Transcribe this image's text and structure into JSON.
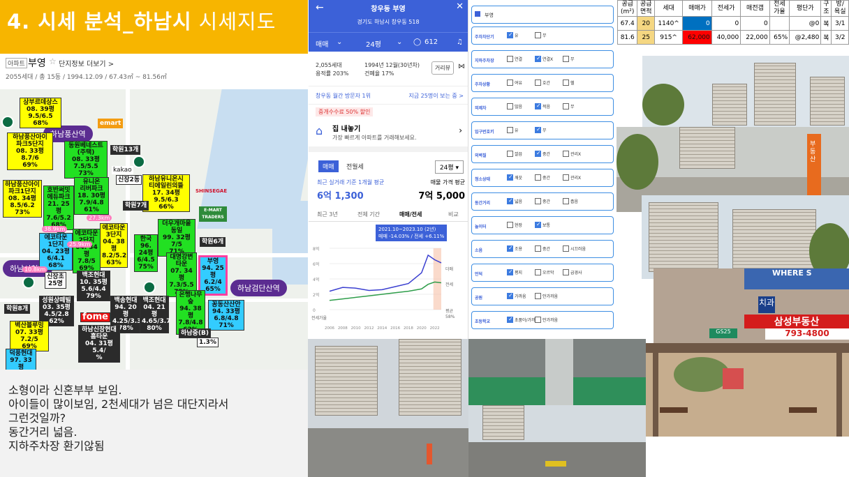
{
  "title": {
    "main": "4. 시세 분석_하남시",
    "sub": "시세지도"
  },
  "apartment": {
    "tag": "아파트",
    "name": "부영",
    "more": "단지정보 더보기 >",
    "summary": "2055세대 / 총 15동 / 1994.12.09 / 67.43㎡ ~ 81.56㎡"
  },
  "map": {
    "stations": [
      "하남풍산역",
      "하남시청역",
      "하남검단산역"
    ],
    "brands": [
      "emart",
      "kakao",
      "신장2동",
      "SHINSEGAE",
      "E-MART TRADERS",
      "fome"
    ],
    "labels": [
      {
        "text": "상부르데상스\n08. 39평\n9.5/6.5\n68%",
        "color": "y"
      },
      {
        "text": "하남풍산아이\n파크5단지\n08. 33평\n8.7/6\n69%",
        "color": "y"
      },
      {
        "text": "동원베네스트\n(주택)\n08. 33평\n7.5/5.5\n73%",
        "color": "g"
      },
      {
        "text": "학원13개",
        "color": "dk"
      },
      {
        "text": "하남풍산아이\n파크1단지\n08. 34평\n8.5/6.2\n73%",
        "color": "y"
      },
      {
        "text": "호반써밋\n에듀파크\n21. 25평\n7.6/5.2\n68%",
        "color": "g"
      },
      {
        "text": "유니온\n리버파크\n18. 30평\n7.9/4.8\n61%",
        "color": "g"
      },
      {
        "text": "하남유니온시\n티에일린의뜰\n17. 34평\n9.5/6.3\n66%",
        "color": "y"
      },
      {
        "text": "에코타운\n1단지\n04. 23평\n6/4.1\n68%",
        "color": "c"
      },
      {
        "text": "에코타운\n2단지\n04. 34평\n7.8/5\n69%",
        "color": "g"
      },
      {
        "text": "에코타운\n3단지\n04. 38평\n8.2/5.2\n63%",
        "color": "y"
      },
      {
        "text": "한국\n96. 24평\n6/4.5\n75%",
        "color": "g"
      },
      {
        "text": "더우개마을\n동일\n99. 32평\n7/5\n71%",
        "color": "g"
      },
      {
        "text": "대명강변\n타운\n07. 34평\n7.3/5.5\n75%",
        "color": "g"
      },
      {
        "text": "부영\n94. 25평\n6.2/4\n65%",
        "color": "c"
      },
      {
        "text": "학원6개",
        "color": "dk"
      },
      {
        "text": "신장초\n25명",
        "color": "w"
      },
      {
        "text": "백조현대\n10. 35평\n5.6/4.4\n79%",
        "color": "dk"
      },
      {
        "text": "성원상떼빌\n03. 35평\n4.5/2.8\n62%",
        "color": "dk"
      },
      {
        "text": "백송현대\n94. 20평\n4.25/3.3\n78%",
        "color": "dk"
      },
      {
        "text": "백조현대\n04. 21평\n4.65/3.7\n80%",
        "color": "dk"
      },
      {
        "text": "은행나무\n숲\n94. 38평\n7.8/4.8\n62%",
        "color": "g"
      },
      {
        "text": "꽁동산산안\n94. 33평\n6.8/4.8\n71%",
        "color": "c"
      },
      {
        "text": "벽산블루밍\n07. 33평\n7.2/5\n69%",
        "color": "y"
      },
      {
        "text": "하남신장현대\n홈타운\n04. 31평\n5.4/\n%",
        "color": "dk"
      },
      {
        "text": "덕풍현대\n97. 33평",
        "color": "c"
      },
      {
        "text": "학원8개",
        "color": "dk"
      },
      {
        "text": "학원7개",
        "color": "dk"
      },
      {
        "text": "하남중(B)",
        "color": "dk"
      }
    ],
    "pills": [
      "27.3km",
      "25.9km",
      "10.8km",
      "38.9km"
    ],
    "badge": "1.3%"
  },
  "memo": [
    "소형이라 신혼부부 보임.",
    "아이들이 많이보임, 2천세대가 넘은 대단지라서",
    "그런것일까?",
    "동간거리 넓음.",
    "지하주차장 환기않됨"
  ],
  "app": {
    "name": "창우동 부영",
    "address": "경기도 하남시 창우동 518",
    "tabs": [
      "매매",
      "24평",
      "612"
    ],
    "stats": [
      "2,055세대",
      "용적률 203%",
      "1994년 12월(30년차)",
      "건폐율 17%"
    ],
    "dist_button": "거리뷰",
    "visit": "창우동 월간 방문자 1위",
    "visit_right": "지금 25명이 보는 중 >",
    "fee_badge": "중개수수료 50% 할인",
    "promo_title": "집 내놓기",
    "promo_sub": "가장 빠르게 아파트를 거래해보세요.",
    "chart_tabs": [
      "매매",
      "전월세"
    ],
    "size_select": "24평",
    "recent_label": "최근 실거래 기준 1개월 평균",
    "recent_price": "6억 1,300",
    "ask_label": "매물 가격 평균",
    "ask_price": "7억 5,000",
    "period_tabs": [
      "최근 3년",
      "전체 기간",
      "매매/전세",
      "비교"
    ],
    "tooltip_period": "2021.10~2023.10 (2년)",
    "tooltip_change": "매매 -14.03% / 전세 +6.11%",
    "y_ticks": [
      "8억",
      "6억",
      "4억",
      "2억",
      "0"
    ],
    "bottom_label": "전세가율",
    "right_labels": [
      "더매",
      "전세",
      "평균",
      "58%"
    ],
    "x_ticks": [
      "2006",
      "2008",
      "2010",
      "2012",
      "2014",
      "2016",
      "2018",
      "2020",
      "2022"
    ]
  },
  "checklist": {
    "header": "부영",
    "rows": [
      {
        "label": "주차차단기",
        "opts": [
          [
            "유",
            true
          ],
          [
            "무",
            false
          ]
        ]
      },
      {
        "label": "지하주차장",
        "opts": [
          [
            "연결",
            false
          ],
          [
            "연결X",
            true
          ],
          [
            "무",
            false
          ]
        ]
      },
      {
        "label": "주차상황",
        "opts": [
          [
            "여유",
            false
          ],
          [
            "호간",
            false
          ],
          [
            "헬",
            false
          ]
        ]
      },
      {
        "label": "외제차",
        "opts": [
          [
            "많음",
            false
          ],
          [
            "적음",
            true
          ],
          [
            "무",
            false
          ]
        ]
      },
      {
        "label": "입구번호키",
        "opts": [
          [
            "유",
            false
          ],
          [
            "무",
            true
          ]
        ]
      },
      {
        "label": "외벽칠",
        "opts": [
          [
            "깔끔",
            false
          ],
          [
            "중간",
            true
          ],
          [
            "관리X",
            false
          ]
        ]
      },
      {
        "label": "청소상태",
        "opts": [
          [
            "깨끗",
            true
          ],
          [
            "중간",
            false
          ],
          [
            "관리X",
            false
          ]
        ]
      },
      {
        "label": "동간거리",
        "opts": [
          [
            "넓음",
            true
          ],
          [
            "중간",
            false
          ],
          [
            "좁음",
            false
          ]
        ]
      },
      {
        "label": "놀이터",
        "opts": [
          [
            "현장",
            false
          ],
          [
            "보통",
            true
          ]
        ]
      },
      {
        "label": "소음",
        "opts": [
          [
            "조용",
            true
          ],
          [
            "중간",
            false
          ],
          [
            "시끄러움",
            false
          ]
        ]
      },
      {
        "label": "언덕",
        "opts": [
          [
            "평지",
            true
          ],
          [
            "오르막",
            false
          ],
          [
            "급경사",
            false
          ]
        ]
      },
      {
        "label": "공원",
        "opts": [
          [
            "가까움",
            true
          ],
          [
            "안가까움",
            false
          ]
        ]
      },
      {
        "label": "초등학교",
        "opts": [
          [
            "초품아/가까움",
            true
          ],
          [
            "안가까움",
            false
          ]
        ]
      }
    ]
  },
  "table": {
    "headers": [
      "공급\n(m²)",
      "공급\n면적",
      "세대",
      "매매가",
      "전세가",
      "매전갭",
      "전세\n가율",
      "평단가",
      "구\n조",
      "방/\n욕실"
    ],
    "rows": [
      [
        "67.4",
        "20",
        "1140^",
        "0",
        "0",
        "0",
        "",
        "@0",
        "복",
        "3/1"
      ],
      [
        "81.6",
        "25",
        "915^",
        "62,000",
        "40,000",
        "22,000",
        "65%",
        "@2,480",
        "복",
        "3/2"
      ]
    ],
    "colors": {
      "area_bg": "#f5d782",
      "blue_cell": "#0070c0",
      "red_cell": "#ff0000"
    }
  },
  "photos": {
    "shop_signs": [
      "WHERE S",
      "삼성부동산",
      "793-4800",
      "부동산",
      "치과",
      "GS25"
    ]
  },
  "chart_data": {
    "type": "line",
    "x": [
      2006,
      2008,
      2010,
      2012,
      2014,
      2016,
      2018,
      2020,
      2021,
      2022,
      2023
    ],
    "series": [
      {
        "name": "매매",
        "values": [
          2.4,
          2.9,
          2.8,
          2.5,
          2.6,
          3.0,
          3.4,
          4.8,
          7.1,
          6.5,
          6.1
        ]
      },
      {
        "name": "전세",
        "values": [
          1.2,
          1.4,
          1.6,
          1.8,
          2.0,
          2.2,
          2.4,
          2.7,
          3.3,
          3.6,
          3.5
        ]
      }
    ],
    "ylim": [
      0,
      8
    ],
    "colors": {
      "매매": "#3a3fd0",
      "전세": "#2e9d4a"
    }
  }
}
